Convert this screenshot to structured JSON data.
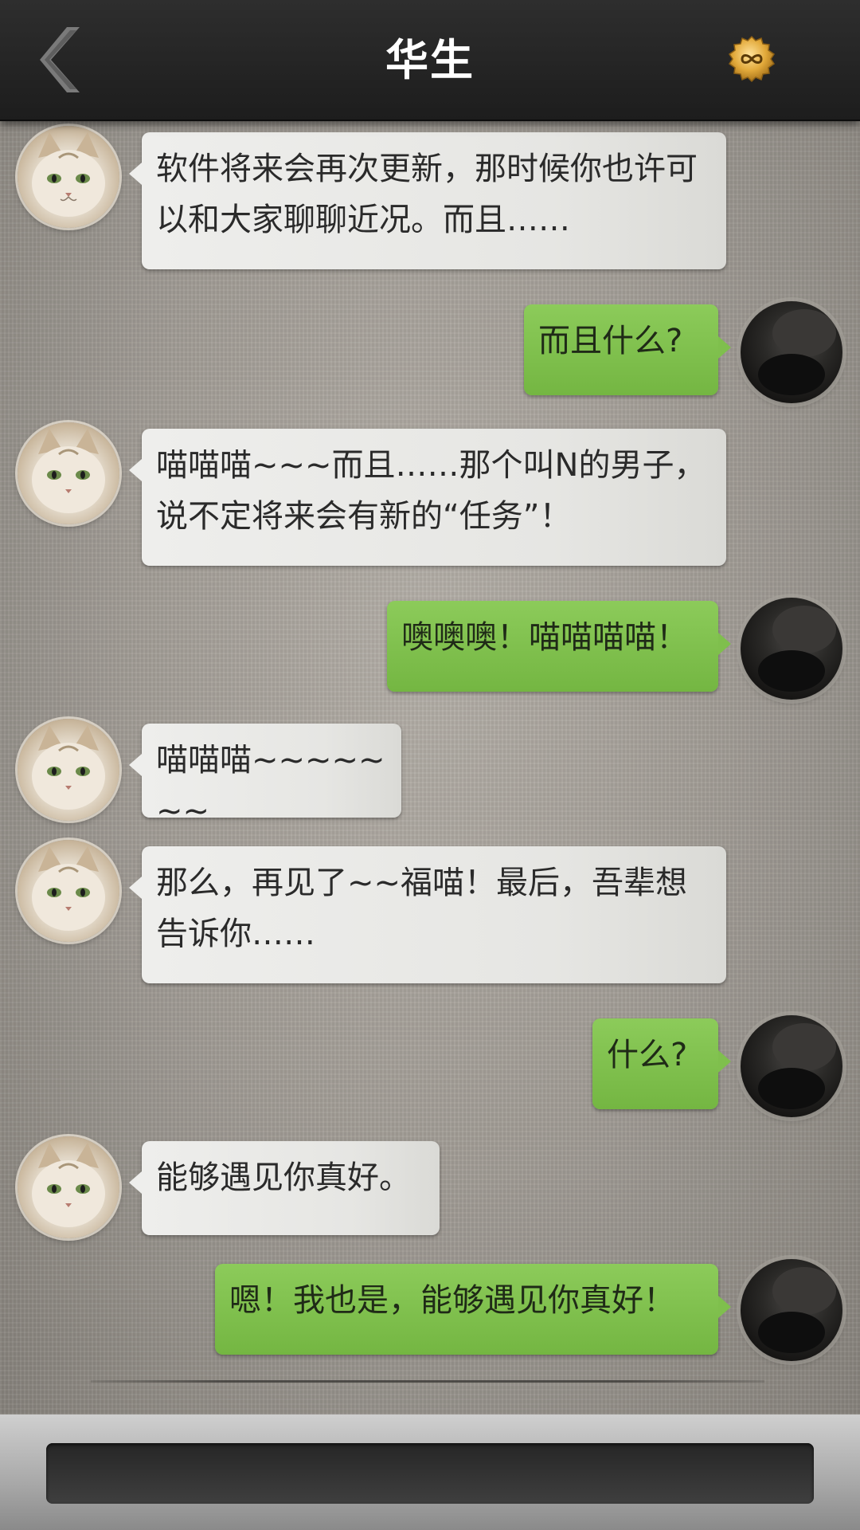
{
  "header": {
    "title": "华生",
    "back_icon": "chevron-left-icon",
    "right_icon": "infinity-coin-icon"
  },
  "messages": [
    {
      "side": "in",
      "avatar": "cat",
      "text": "软件将来会再次更新，那时候你也许可以和大家聊聊近况。而且……"
    },
    {
      "side": "out",
      "avatar": "dark",
      "text": "而且什么?"
    },
    {
      "side": "in",
      "avatar": "cat",
      "text": "喵喵喵~~~而且……那个叫N的男子，说不定将来会有新的“任务”！"
    },
    {
      "side": "out",
      "avatar": "dark",
      "text": "噢噢噢！喵喵喵喵！"
    },
    {
      "side": "in",
      "avatar": "cat",
      "text": "喵喵喵~~~~~~~"
    },
    {
      "side": "in",
      "avatar": "cat",
      "text": "那么，再见了~~福喵！最后，吾辈想告诉你……"
    },
    {
      "side": "out",
      "avatar": "dark",
      "text": "什么?"
    },
    {
      "side": "in",
      "avatar": "cat",
      "text": "能够遇见你真好。"
    },
    {
      "side": "out",
      "avatar": "dark",
      "text": "嗯！我也是，能够遇见你真好！"
    }
  ],
  "input": {
    "value": "",
    "placeholder": ""
  },
  "colors": {
    "header_bg": "#242424",
    "incoming_bubble": "#e9e9e6",
    "outgoing_bubble": "#82c250",
    "text": "#2a2a2a"
  }
}
